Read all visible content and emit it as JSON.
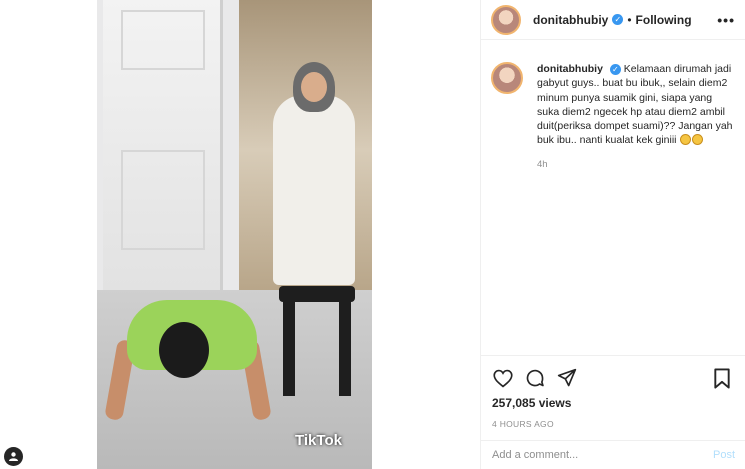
{
  "post": {
    "username": "donitabhubiy",
    "follow_status": "Following",
    "more_label": "•••",
    "caption": "Kelamaan dirumah jadi gabyut guys.. buat bu ibuk,, selain diem2 minum punya suamik gini, siapa yang suka diem2 ngecek hp atau diem2 ambil duit(periksa dompet suami)?? Jangan yah buk ibu.. nanti kualat kek giniii",
    "caption_time": "4h",
    "views": "257,085 views",
    "posted_ago": "4 HOURS AGO"
  },
  "media": {
    "watermark": "TikTok"
  },
  "comment": {
    "placeholder": "Add a comment...",
    "post_label": "Post"
  },
  "icons": {
    "verified": "verified-badge-icon",
    "like": "heart-icon",
    "comment": "comment-bubble-icon",
    "share": "paper-plane-icon",
    "save": "bookmark-icon",
    "emoji": "grimacing-face-emoji"
  },
  "colors": {
    "verified_blue": "#3897f0",
    "secondary_text": "#8e8e8e",
    "post_button_disabled": "#b2dffc"
  }
}
